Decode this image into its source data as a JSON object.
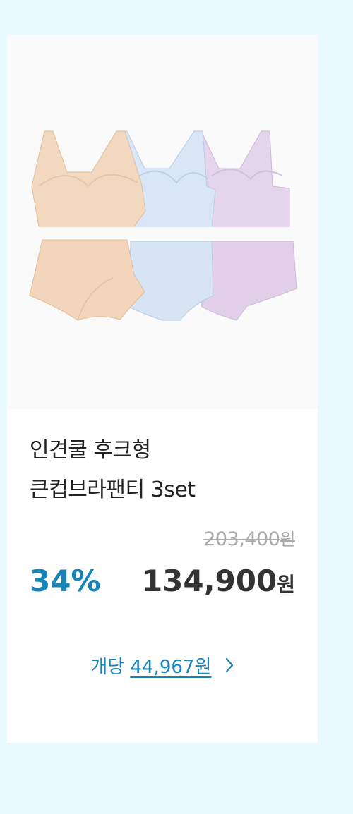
{
  "product": {
    "title_line1": "인견쿨 후크형",
    "title_line2": "큰컵브라팬티 3set",
    "original_price": "203,400",
    "original_currency": "원",
    "discount": "34%",
    "sale_price": "134,900",
    "sale_currency": "원",
    "unit_prefix": "개당",
    "unit_price": "44,967원"
  },
  "colors": {
    "page_bg": "#e8f9ff",
    "accent": "#1684b8",
    "beige": "#f2d6bd",
    "blue": "#d6e5f4",
    "lavender": "#e2d2ea"
  },
  "icons": {
    "unit_chevron": "chevron-right-icon"
  }
}
